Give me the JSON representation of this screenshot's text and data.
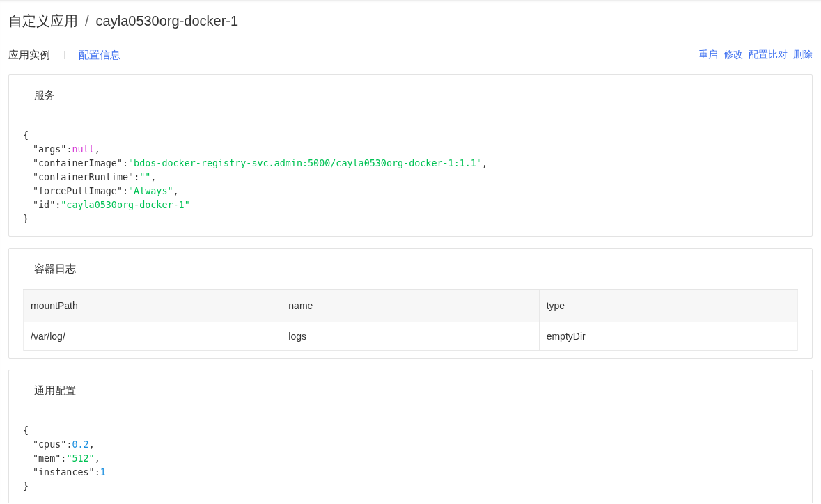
{
  "breadcrumb": {
    "parent": "自定义应用",
    "separator": "/",
    "current": "cayla0530org-docker-1"
  },
  "tabs": [
    {
      "label": "应用实例",
      "selected": false
    },
    {
      "label": "配置信息",
      "selected": true
    }
  ],
  "actions": [
    "重启",
    "修改",
    "配置比对",
    "删除"
  ],
  "sections": [
    {
      "kind": "json",
      "title": "服务",
      "open": "{",
      "close": "}",
      "entries": [
        {
          "key": "\"args\"",
          "sep": ":",
          "value": "null",
          "kind": "null",
          "comma": ","
        },
        {
          "key": "\"containerImage\"",
          "sep": ":",
          "value": "\"bdos-docker-registry-svc.admin:5000/cayla0530org-docker-1:1.1\"",
          "kind": "string",
          "comma": ","
        },
        {
          "key": "\"containerRuntime\"",
          "sep": ":",
          "value": "\"\"",
          "kind": "string",
          "comma": ","
        },
        {
          "key": "\"forcePullImage\"",
          "sep": ":",
          "value": "\"Always\"",
          "kind": "string",
          "comma": ","
        },
        {
          "key": "\"id\"",
          "sep": ":",
          "value": "\"cayla0530org-docker-1\"",
          "kind": "string"
        }
      ]
    },
    {
      "kind": "table",
      "title": "容器日志",
      "columns": [
        "mountPath",
        "name",
        "type"
      ],
      "rows": [
        [
          "/var/log/",
          "logs",
          "emptyDir"
        ]
      ]
    },
    {
      "kind": "json",
      "title": "通用配置",
      "open": "{",
      "close": "}",
      "entries": [
        {
          "key": "\"cpus\"",
          "sep": ":",
          "value": "0.2",
          "kind": "number",
          "comma": ","
        },
        {
          "key": "\"mem\"",
          "sep": ":",
          "value": "\"512\"",
          "kind": "string",
          "comma": ","
        },
        {
          "key": "\"instances\"",
          "sep": ":",
          "value": "1",
          "kind": "number"
        }
      ]
    }
  ]
}
